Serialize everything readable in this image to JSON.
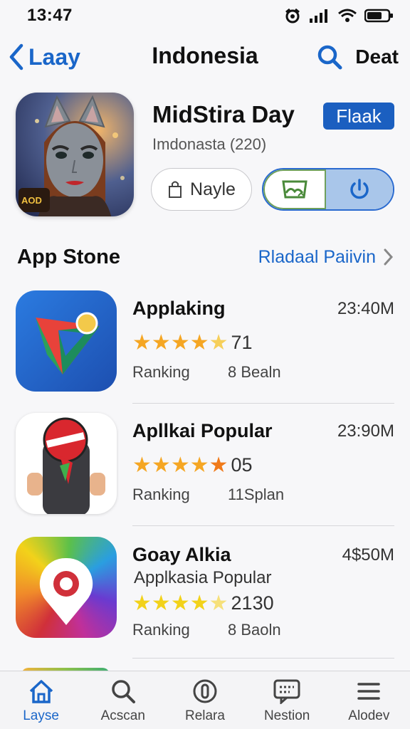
{
  "status_bar": {
    "time": "13:47"
  },
  "nav": {
    "back_label": "Laay",
    "title": "Indonesia",
    "action_label": "Deat"
  },
  "hero": {
    "title": "MidStira Day",
    "badge": "Flaak",
    "subtitle": "Imdonasta (220)",
    "pill_label": "Nayle",
    "icon_text": "AOD"
  },
  "section": {
    "title": "App Stone",
    "link": "Rladaal Paiivin"
  },
  "apps": [
    {
      "name": "Applaking",
      "subtitle": "",
      "time": "23:40M",
      "rating": 4.5,
      "rating_count": "71",
      "meta_left": "Ranking",
      "meta_right": "8 Bealn",
      "icon": "play-triangle-icon"
    },
    {
      "name": "Apllkai Popular",
      "subtitle": "",
      "time": "23:90M",
      "rating": 5,
      "rating_count": "05",
      "meta_left": "Ranking",
      "meta_right": "11Splan",
      "icon": "stop-sign-icon"
    },
    {
      "name": "Goay Alkia",
      "subtitle": "Applkasia Popular",
      "time": "4$50M",
      "rating": 4.5,
      "rating_count": "2130",
      "meta_left": "Ranking",
      "meta_right": "8 Baoln",
      "icon": "map-pin-icon"
    }
  ],
  "tabs": [
    {
      "label": "Layse",
      "icon": "home-icon",
      "active": true
    },
    {
      "label": "Acscan",
      "icon": "search-icon",
      "active": false
    },
    {
      "label": "Relara",
      "icon": "circle-icon",
      "active": false
    },
    {
      "label": "Nestion",
      "icon": "message-icon",
      "active": false
    },
    {
      "label": "Alodev",
      "icon": "menu-icon",
      "active": false
    }
  ],
  "colors": {
    "accent": "#1a66c9",
    "badge": "#1b5fc0",
    "star_gold": "#f5a623",
    "star_yellow": "#f2d21a"
  }
}
